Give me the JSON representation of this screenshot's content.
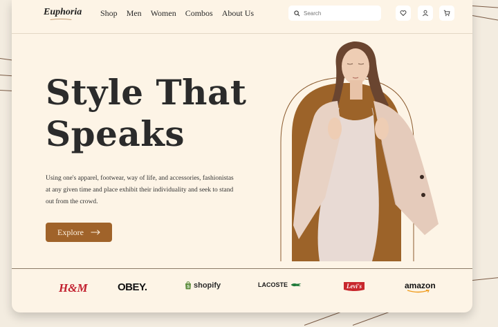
{
  "nav": {
    "logo": "Euphoria",
    "menu": [
      "Shop",
      "Men",
      "Women",
      "Combos",
      "About Us"
    ],
    "search_placeholder": "Search"
  },
  "hero": {
    "headline_line1": "Style That",
    "headline_line2": "Speaks",
    "description": "Using one's apparel, footwear, way of life, and accessories, fashionistas at any given time and place exhibit their individuality and seek to stand out from the crowd.",
    "cta_label": "Explore"
  },
  "brands": {
    "hm": "H&M",
    "obey": "OBEY.",
    "shopify": "shopify",
    "lacoste": "LACOSTE",
    "levis": "Levi's",
    "amazon": "amazon"
  },
  "colors": {
    "background": "#fdf4e6",
    "accent": "#a0632a",
    "text": "#2b2b2b"
  }
}
